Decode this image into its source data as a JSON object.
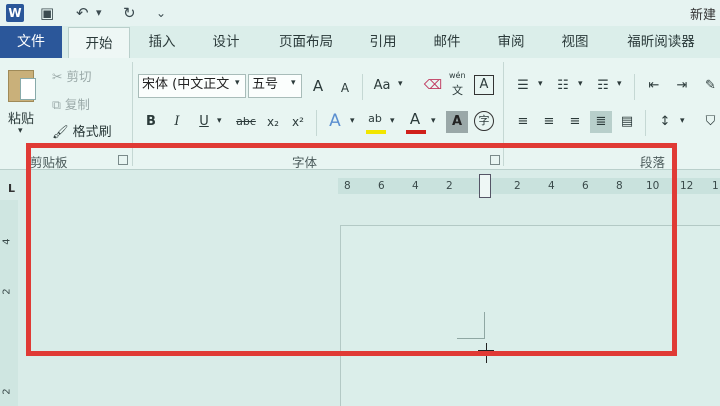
{
  "titlebar": {
    "app_icon_letter": "W",
    "doc_title": "新建",
    "undo_glyph": "↶",
    "redo_glyph": "↻",
    "customize_glyph": "⌄",
    "save_glyph": "▣"
  },
  "tabs": {
    "file": "文件",
    "items": [
      {
        "label": "开始",
        "active": true
      },
      {
        "label": "插入"
      },
      {
        "label": "设计"
      },
      {
        "label": "页面布局"
      },
      {
        "label": "引用"
      },
      {
        "label": "邮件"
      },
      {
        "label": "审阅"
      },
      {
        "label": "视图"
      },
      {
        "label": "福昕阅读器"
      }
    ]
  },
  "clipboard": {
    "paste": "粘贴",
    "cut": "剪切",
    "copy": "复制",
    "format_painter": "格式刷",
    "group_label": "剪贴板"
  },
  "font": {
    "font_name": "宋体 (中文正文",
    "font_size": "五号",
    "grow": "A",
    "shrink": "A",
    "change_case": "Aa",
    "phonetic_top": "wén",
    "phonetic_bottom": "文",
    "char_border": "A",
    "bold": "B",
    "italic": "I",
    "underline": "U",
    "strike": "abc",
    "subscript": "x₂",
    "superscript": "x²",
    "text_effect": "A",
    "highlight": "ab",
    "font_color": "A",
    "char_shading": "A",
    "enclose_char": "字",
    "group_label": "字体"
  },
  "paragraph": {
    "group_label": "段落"
  },
  "ruler": {
    "corner": "L",
    "ticks": [
      "8",
      "6",
      "4",
      "2",
      "2",
      "4",
      "6",
      "8",
      "10",
      "12",
      "1"
    ],
    "vticks": [
      "4",
      "2",
      "2"
    ]
  },
  "colors": {
    "accent": "#2b579a",
    "highlight_border": "#e03a35",
    "highlight_yellow": "#f2e600",
    "font_red": "#d0201a"
  }
}
